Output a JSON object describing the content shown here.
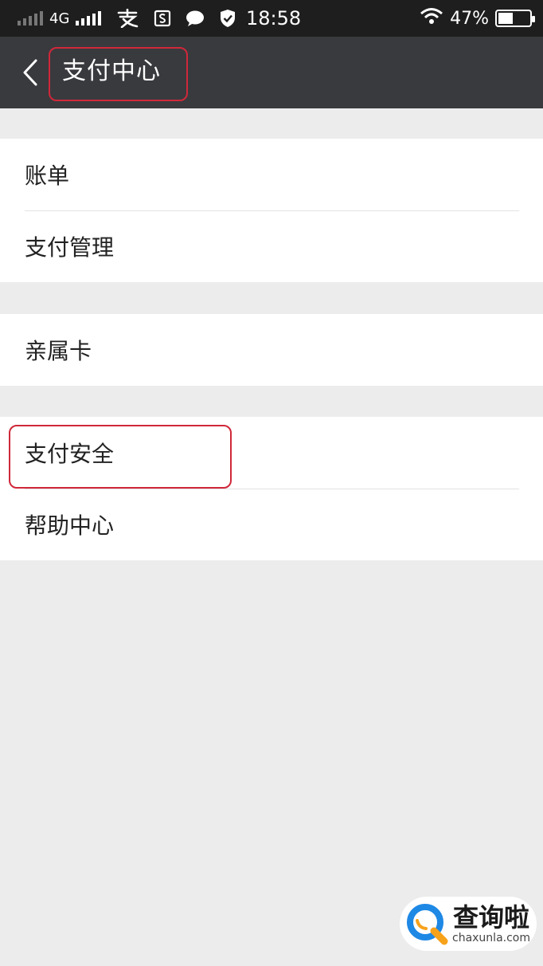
{
  "status_bar": {
    "network": "4G",
    "time": "18:58",
    "battery": "47%",
    "battery_level": 0.47,
    "icons": [
      "signal-sim2-icon",
      "signal-sim1-icon",
      "alipay-icon",
      "s-badge-icon",
      "message-bubble-icon",
      "shield-check-icon",
      "wifi-icon",
      "battery-icon"
    ]
  },
  "nav": {
    "back_icon": "chevron-left-icon",
    "title": "支付中心"
  },
  "groups": [
    {
      "items": [
        "账单",
        "支付管理"
      ]
    },
    {
      "items": [
        "亲属卡"
      ]
    },
    {
      "items": [
        "支付安全",
        "帮助中心"
      ]
    }
  ],
  "highlight_color": "#d0283a",
  "watermark": {
    "cn": "查询啦",
    "en": "chaxunla.com",
    "logo_colors": [
      "#1e88e5",
      "#f7a21b"
    ]
  }
}
